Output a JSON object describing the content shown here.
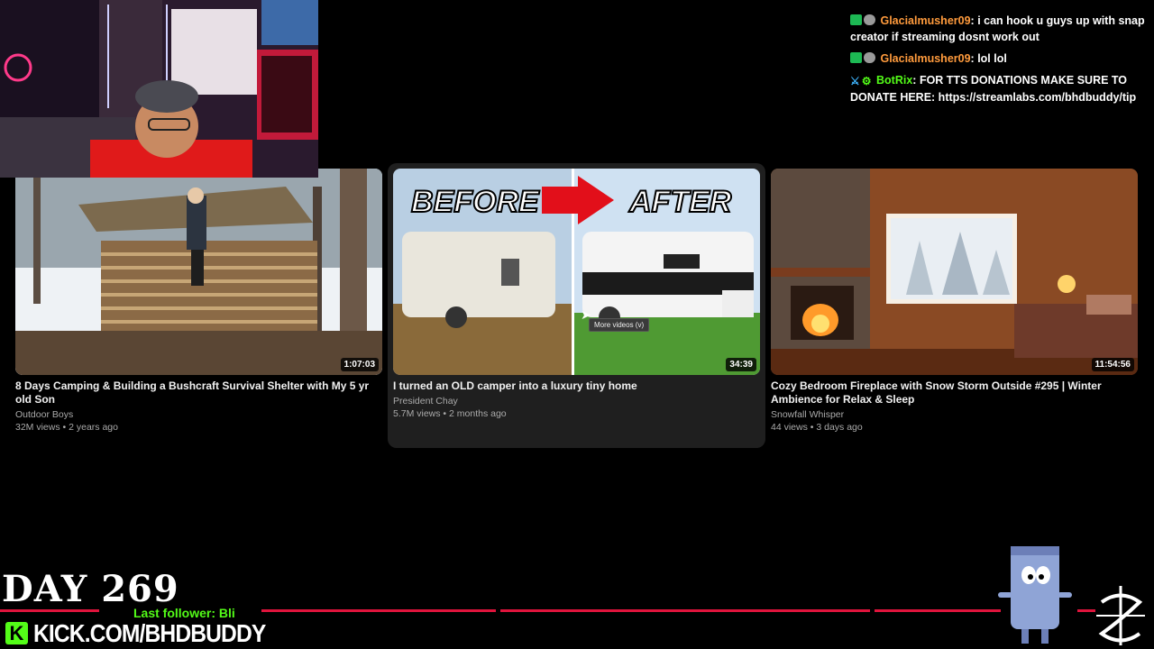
{
  "chat": [
    {
      "badges": [
        "green",
        "gray"
      ],
      "user": "Glacialmusher09",
      "message": "i can hook u guys up with snap creator if streaming dosnt work out"
    },
    {
      "badges": [
        "green",
        "gray"
      ],
      "user": "Glacialmusher09",
      "message": "lol lol"
    },
    {
      "badges": [
        "sword-icon",
        "gear-icon"
      ],
      "user": "BotRix",
      "message": "FOR TTS DONATIONS MAKE SURE TO DONATE HERE: https://streamlabs.com/bhdbuddy/tip"
    }
  ],
  "videos": [
    {
      "title": "8 Days Camping & Building a Bushcraft Survival Shelter with My 5 yr old Son",
      "channel": "Outdoor Boys",
      "meta": "32M views • 2 years ago",
      "duration": "1:07:03"
    },
    {
      "title": "I turned an OLD camper into a luxury tiny home",
      "channel": "President Chay",
      "meta": "5.7M views • 2 months ago",
      "duration": "34:39",
      "thumb_text_left": "BEFORE",
      "thumb_text_right": "AFTER",
      "tooltip": "More videos (v)"
    },
    {
      "title": "Cozy Bedroom Fireplace with Snow Storm Outside #295 | Winter Ambience for Relax & Sleep",
      "channel": "Snowfall Whisper",
      "meta": "44 views • 3 days ago",
      "duration": "11:54:56"
    }
  ],
  "overlay": {
    "day": "DAY 269",
    "last_follower": "Last follower: Bli",
    "kick_url": "KICK.COM/BHDBUDDY",
    "kick_logo": "K",
    "accent": "#e0143c",
    "kick_green": "#53fc18"
  }
}
